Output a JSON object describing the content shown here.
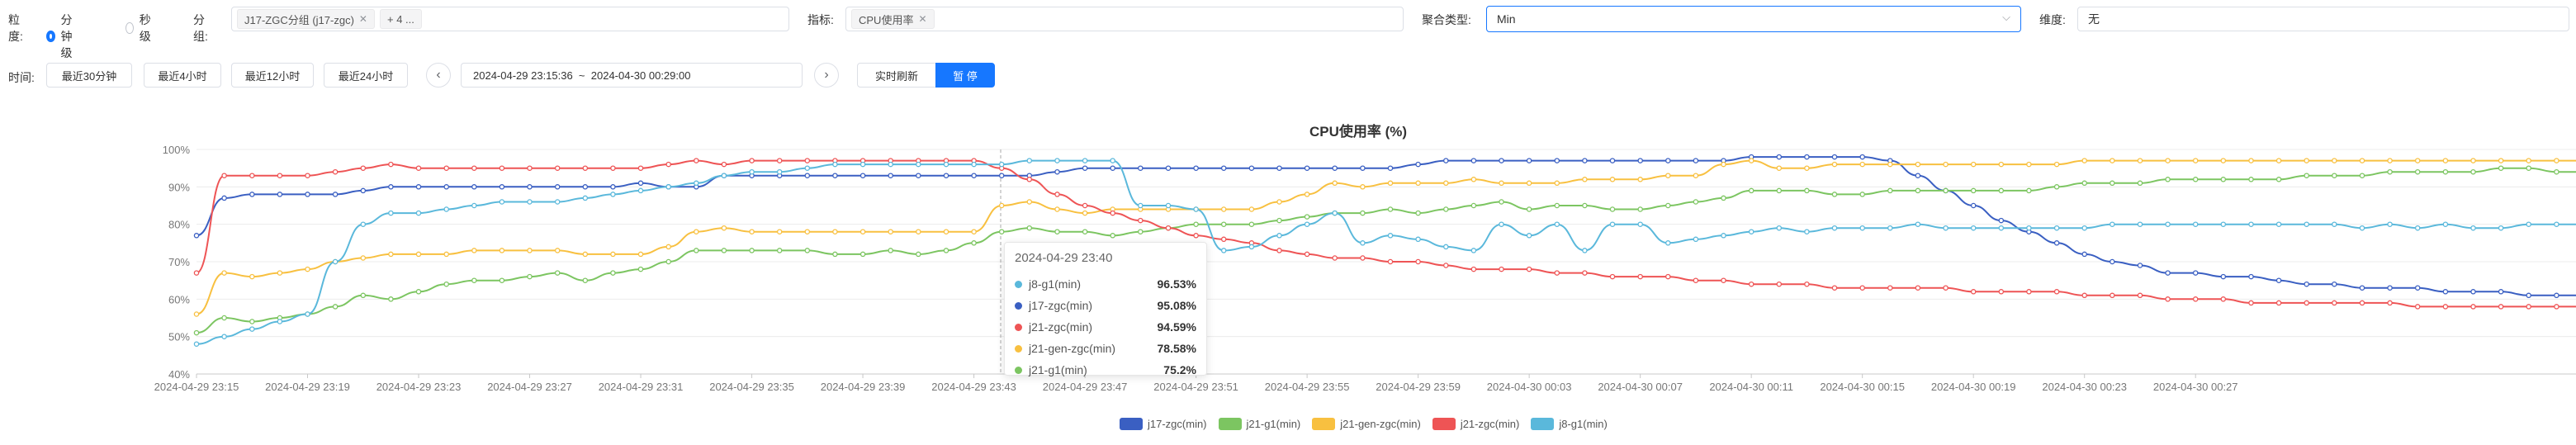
{
  "filters": {
    "granularity_label": "粒度:",
    "granularity_options": [
      "分钟级",
      "秒级"
    ],
    "group_label": "分组:",
    "group_tags": [
      "J17-ZGC分组 (j17-zgc)",
      "+ 4 ..."
    ],
    "metric_label": "指标:",
    "metric_tags": [
      "CPU使用率"
    ],
    "agg_label": "聚合类型:",
    "agg_value": "Min",
    "dim_label": "维度:",
    "dim_value": "无"
  },
  "timebar": {
    "label": "时间:",
    "quick": [
      "最近30分钟",
      "最近4小时",
      "最近12小时",
      "最近24小时"
    ],
    "range": "2024-04-29 23:15:36  ~  2024-04-30 00:29:00",
    "realtime": "实时刷新",
    "pause": "暂 停"
  },
  "tooltip": {
    "title": "2024-04-29 23:40",
    "rows": [
      {
        "name": "j8-g1(min)",
        "value": "96.53%",
        "color": "#5ab8db"
      },
      {
        "name": "j17-zgc(min)",
        "value": "95.08%",
        "color": "#3a5fc2"
      },
      {
        "name": "j21-zgc(min)",
        "value": "94.59%",
        "color": "#ee5455"
      },
      {
        "name": "j21-gen-zgc(min)",
        "value": "78.58%",
        "color": "#f8c040"
      },
      {
        "name": "j21-g1(min)",
        "value": "75.2%",
        "color": "#7cc561"
      }
    ]
  },
  "chart_data": {
    "type": "line",
    "title": "CPU使用率 (%)",
    "ylim": [
      40,
      100
    ],
    "yticks": [
      "40%",
      "50%",
      "60%",
      "70%",
      "80%",
      "90%",
      "100%"
    ],
    "xticks": [
      "2024-04-29 23:15",
      "2024-04-29 23:19",
      "2024-04-29 23:23",
      "2024-04-29 23:27",
      "2024-04-29 23:31",
      "2024-04-29 23:35",
      "2024-04-29 23:39",
      "2024-04-29 23:43",
      "2024-04-29 23:47",
      "2024-04-29 23:51",
      "2024-04-29 23:55",
      "2024-04-29 23:59",
      "2024-04-30 00:03",
      "2024-04-30 00:07",
      "2024-04-30 00:11",
      "2024-04-30 00:15",
      "2024-04-30 00:19",
      "2024-04-30 00:23",
      "2024-04-30 00:27"
    ],
    "x_start": "23:15",
    "x_interval_min": 1,
    "series": [
      {
        "name": "j17-zgc(min)",
        "color": "#3a5fc2",
        "values": [
          77,
          87,
          88,
          88,
          88,
          88,
          89,
          90,
          90,
          90,
          90,
          90,
          90,
          90,
          90,
          90,
          91,
          90,
          90,
          93,
          93,
          93,
          93,
          93,
          93,
          93,
          93,
          93,
          93,
          93,
          93,
          94,
          95,
          95,
          95,
          95,
          95,
          95,
          95,
          95,
          95,
          95,
          95,
          95,
          96,
          97,
          97,
          97,
          97,
          97,
          97,
          97,
          97,
          97,
          97,
          97,
          98,
          98,
          98,
          98,
          98,
          97,
          93,
          89,
          85,
          81,
          78,
          75,
          72,
          70,
          69,
          67,
          67,
          66,
          66,
          65,
          64,
          64,
          63,
          63,
          63,
          62,
          62,
          62,
          61,
          61,
          61
        ]
      },
      {
        "name": "j21-g1(min)",
        "color": "#7cc561",
        "values": [
          51,
          55,
          54,
          55,
          56,
          58,
          61,
          60,
          62,
          64,
          65,
          65,
          66,
          67,
          65,
          67,
          68,
          70,
          73,
          73,
          73,
          73,
          73,
          72,
          72,
          73,
          72,
          73,
          75,
          78,
          79,
          78,
          78,
          77,
          78,
          79,
          80,
          80,
          80,
          81,
          82,
          83,
          83,
          84,
          83,
          84,
          85,
          86,
          84,
          85,
          85,
          84,
          84,
          85,
          86,
          87,
          89,
          89,
          89,
          88,
          88,
          89,
          89,
          89,
          89,
          89,
          89,
          90,
          91,
          91,
          91,
          92,
          92,
          92,
          92,
          92,
          93,
          93,
          93,
          94,
          94,
          94,
          94,
          95,
          95,
          94,
          94
        ]
      },
      {
        "name": "j21-gen-zgc(min)",
        "color": "#f8c040",
        "values": [
          56,
          67,
          66,
          67,
          68,
          70,
          71,
          72,
          72,
          72,
          73,
          73,
          73,
          73,
          72,
          72,
          72,
          74,
          78,
          79,
          78,
          78,
          78,
          78,
          78,
          78,
          78,
          78,
          78,
          85,
          86,
          84,
          83,
          84,
          84,
          84,
          84,
          84,
          84,
          86,
          88,
          91,
          90,
          91,
          91,
          91,
          92,
          91,
          91,
          91,
          92,
          92,
          92,
          93,
          93,
          96,
          97,
          95,
          95,
          96,
          96,
          96,
          96,
          96,
          96,
          96,
          96,
          96,
          97,
          97,
          97,
          97,
          97,
          97,
          97,
          97,
          97,
          97,
          97,
          97,
          97,
          97,
          97,
          97,
          97,
          97,
          97
        ]
      },
      {
        "name": "j21-zgc(min)",
        "color": "#ee5455",
        "values": [
          67,
          93,
          93,
          93,
          93,
          94,
          95,
          96,
          95,
          95,
          95,
          95,
          95,
          95,
          95,
          95,
          95,
          96,
          97,
          96,
          97,
          97,
          97,
          97,
          97,
          97,
          97,
          97,
          97,
          95,
          92,
          88,
          85,
          83,
          81,
          79,
          77,
          76,
          75,
          73,
          72,
          71,
          71,
          70,
          70,
          69,
          68,
          68,
          68,
          67,
          67,
          66,
          66,
          66,
          65,
          65,
          64,
          64,
          64,
          63,
          63,
          63,
          63,
          63,
          62,
          62,
          62,
          62,
          61,
          61,
          61,
          60,
          60,
          60,
          59,
          59,
          59,
          59,
          59,
          59,
          58,
          58,
          58,
          58,
          58,
          58,
          58
        ]
      },
      {
        "name": "j8-g1(min)",
        "color": "#5ab8db",
        "values": [
          48,
          50,
          52,
          54,
          56,
          70,
          80,
          83,
          83,
          84,
          85,
          86,
          86,
          86,
          87,
          88,
          89,
          90,
          91,
          93,
          94,
          94,
          95,
          96,
          96,
          96,
          96,
          96,
          96,
          96,
          97,
          97,
          97,
          97,
          85,
          85,
          84,
          73,
          74,
          77,
          80,
          83,
          75,
          77,
          76,
          74,
          73,
          80,
          77,
          80,
          73,
          80,
          80,
          75,
          76,
          77,
          78,
          79,
          78,
          79,
          79,
          79,
          80,
          79,
          79,
          79,
          79,
          79,
          79,
          80,
          80,
          80,
          80,
          80,
          80,
          80,
          80,
          80,
          79,
          80,
          79,
          80,
          79,
          79,
          80,
          80,
          80
        ]
      }
    ]
  }
}
